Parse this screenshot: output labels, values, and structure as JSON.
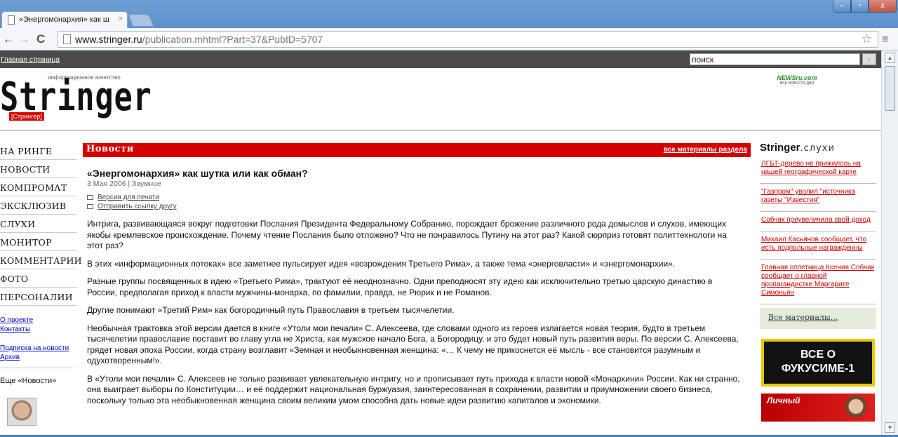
{
  "browser": {
    "tab_title": "«Энергомонархия» как ш",
    "tab_close": "×",
    "url_host": "www.stringer.ru",
    "url_path": "/publication.mhtml?Part=37&PubID=5707",
    "back": "←",
    "forward": "→",
    "reload": "C",
    "star": "☆",
    "menu": "≡",
    "window_buttons": {
      "minimize": "–",
      "maximize": "▫",
      "close": "x"
    }
  },
  "site": {
    "home_link": "Главная страница",
    "search_value": "поиск",
    "search_button": "›",
    "logo_tagline": "информационное агентство",
    "logo_word": "Stringer",
    "logo_sub": "[Стрингер]",
    "newsru_line1": "NEWSru.com",
    "newsru_line2": "ВСЕ НОВОСТИ ДНЯ"
  },
  "leftnav": {
    "items": [
      "НА РИНГЕ",
      "НОВОСТИ",
      "КОМПРОМАТ",
      "ЭКСКЛЮЗИВ",
      "СЛУХИ",
      "МОНИТОР",
      "КОММЕНТАРИИ",
      "ФОТО",
      "ПЕРСОНАЛИИ"
    ],
    "links": [
      "О проекте",
      "Контакты",
      "Подписка на новости",
      "Архив"
    ],
    "more_news": "Еще «Новости»"
  },
  "main": {
    "section_title": "Новости",
    "all_section_link": "все материалы раздела",
    "article": {
      "title": "«Энергомонархия» как шутка или как обман?",
      "date": "3 Мая 2006 | Заумное",
      "print_link": "Версия для печати",
      "send_link": "Отправить ссылку другу",
      "paragraphs": [
        "Интрига, развивающаяся вокруг подготовки Послания Президента Федеральному Собранию, порождает брожение различного рода домыслов и слухов, имеющих якобы кремлевское происхождение. Почему чтение Послания было отложено? Что не понравилось Путину на этот раз? Какой сюрприз готовят политтехнологи на этот раз?",
        "В этих «информационных потоках» все заметнее пульсирует идея «возрождения Третьего Рима», а также тема «энерговласти» и «энергомонархии».",
        "Разные группы посвященных в идею «Третьего Рима», трактуют её неоднозначно. Одни преподносят эту идею как исключительно третью царскую династию в России, предполагая приход к власти мужчины-монарха, по фамилии, правда, не Рюрик и не Романов.",
        "Другие понимают «Третий Рим» как богородичный путь Православия в третьем тысячелетии.",
        "Необычная трактовка этой версии дается в книге «Утоли мои печали» С. Алексеева, где словами одного из героев излагается новая теория, будто в третьем тысячелетии православие поставит во главу угла не Христа, как мужское начало Бога, а Богородицу, и это будет новый путь развития веры. По версии С. Алексеева, грядет новая эпоха России, когда страну возглавит «Земная и необыкновенная женщина: «… К чему не прикоснется её мысль - все становится разумным и одухотворенным!».",
        "В «Утоли мои печали» С. Алексеев не только развивает увлекательную интригу, но и прописывает путь прихода к власти новой «Монархини» России. Как ни странно, она выигрaет выборы по Конституции… и её поддержит национальная буржуазия, заинтересованная в сохранении, развитии и приумножении своего бизнеса, поскольку только эта необыкновенная женщина своим великим умом способна дать новые идеи развитию капиталов и экономики."
      ]
    }
  },
  "right": {
    "head_brand": "Stringer",
    "head_rest": ".слухи",
    "rumors": [
      "ЛГБТ-дерево не прижилось на нашей географической карте",
      "\"Газпром\" уволил \"источника газеты \"Известия\"",
      "Собчак преувеличила свой доход",
      "Михаил Касьянов сообщает, что есть подпольные награжденны",
      "Главная сплетница Ксения Собчак сообщает о главной пропагандистке Маргарите Симоньян"
    ],
    "all_materials": "Все материалы…",
    "banner1_line1": "ВСЕ О",
    "banner1_line2": "ФУКУСИМЕ-1",
    "banner2_text": "Личный"
  }
}
